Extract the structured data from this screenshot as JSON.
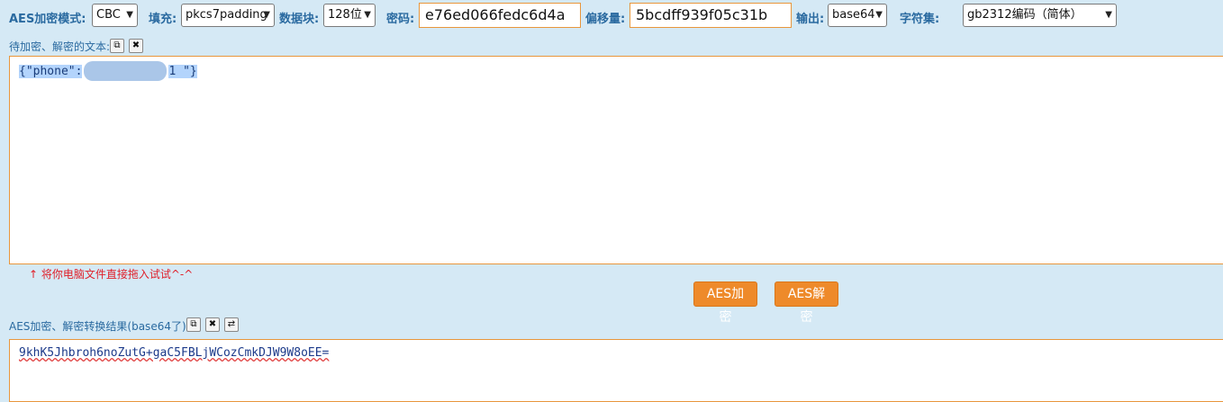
{
  "toolbar": {
    "mode_label": "AES加密模式:",
    "mode_value": "CBC",
    "padding_label": "填充:",
    "padding_value": "pkcs7padding",
    "block_label": "数据块:",
    "block_value": "128位",
    "key_label": "密码:",
    "key_value": "e76ed066fedc6d4a",
    "iv_label": "偏移量:",
    "iv_value": "5bcdff939f05c31b",
    "output_label": "输出:",
    "output_value": "base64",
    "charset_label": "字符集:",
    "charset_value": "gb2312编码（简体）"
  },
  "input_section": {
    "label": "待加密、解密的文本:",
    "text_start": "{\"phone\":",
    "text_end": "1 \"}",
    "drag_hint": "↑ 将你电脑文件直接拖入试试^-^"
  },
  "actions": {
    "encrypt_label": "AES加密",
    "decrypt_label": "AES解密"
  },
  "output_section": {
    "label": "AES加密、解密转换结果(base64了):",
    "result": "9khK5Jhbroh6noZutG+gaC5FBLjWCozCmkDJW9W8oEE="
  },
  "icons": {
    "copy": "copy-icon",
    "clear": "close-icon",
    "swap": "swap-icon"
  },
  "colors": {
    "background": "#d5e9f5",
    "label": "#2a6aa0",
    "accent": "#ee8a2a",
    "hint": "#e0202a"
  }
}
